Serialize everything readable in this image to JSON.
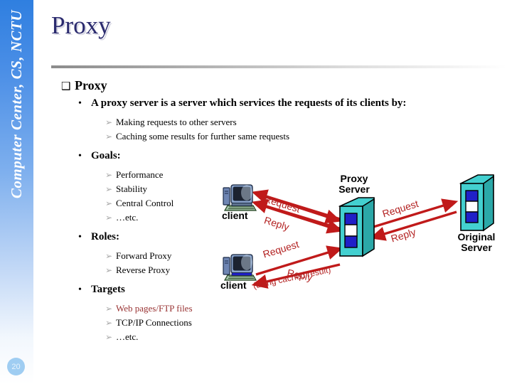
{
  "sidebar": {
    "label": "Computer Center, CS, NCTU",
    "page_number": "20",
    "gradient_top": "#2f7fe0",
    "gradient_bottom": "#ffffff"
  },
  "slide": {
    "title": "Proxy",
    "title_color": "#2a2a6e"
  },
  "content": {
    "section": {
      "marker": "❑",
      "text": "Proxy"
    },
    "blocks": [
      {
        "marker": "•",
        "text": "A proxy server is a server which services the requests of its clients by:",
        "children": [
          {
            "marker": "➢",
            "text": "Making requests to other servers",
            "color": "#000000"
          },
          {
            "marker": "➢",
            "text": "Caching some results for further same requests",
            "color": "#000000"
          }
        ]
      },
      {
        "marker": "•",
        "text": "Goals:",
        "children": [
          {
            "marker": "➢",
            "text": "Performance",
            "color": "#000000"
          },
          {
            "marker": "➢",
            "text": "Stability",
            "color": "#000000"
          },
          {
            "marker": "➢",
            "text": "Central Control",
            "color": "#000000"
          },
          {
            "marker": "➢",
            "text": "…etc.",
            "color": "#000000"
          }
        ]
      },
      {
        "marker": "•",
        "text": "Roles:",
        "children": [
          {
            "marker": "➢",
            "text": "Forward Proxy",
            "color": "#000000"
          },
          {
            "marker": "➢",
            "text": "Reverse Proxy",
            "color": "#000000"
          }
        ]
      },
      {
        "marker": "•",
        "text": "Targets",
        "children": [
          {
            "marker": "➢",
            "text": "Web pages/FTP files",
            "color": "#993333"
          },
          {
            "marker": "➢",
            "text": "TCP/IP Connections",
            "color": "#000000"
          },
          {
            "marker": "➢",
            "text": "…etc.",
            "color": "#000000"
          }
        ]
      }
    ]
  },
  "diagram": {
    "nodes": {
      "client_top": "client",
      "client_bottom": "client",
      "proxy_server": "Proxy\nServer",
      "original_server": "Original\nServer"
    },
    "arrows": {
      "client_top_request": "Request",
      "client_top_reply": "Reply",
      "proxy_origin_request": "Request",
      "proxy_origin_reply": "Reply",
      "client_bottom_request": "Request",
      "client_bottom_reply": "Reply",
      "client_bottom_note": "(using cached result)"
    },
    "colors": {
      "arrow": "#c01a1a",
      "label": "#b32222",
      "server_body": "#43d0d0",
      "server_side": "#2ba8a8",
      "server_stripe": "#2020c8"
    }
  }
}
